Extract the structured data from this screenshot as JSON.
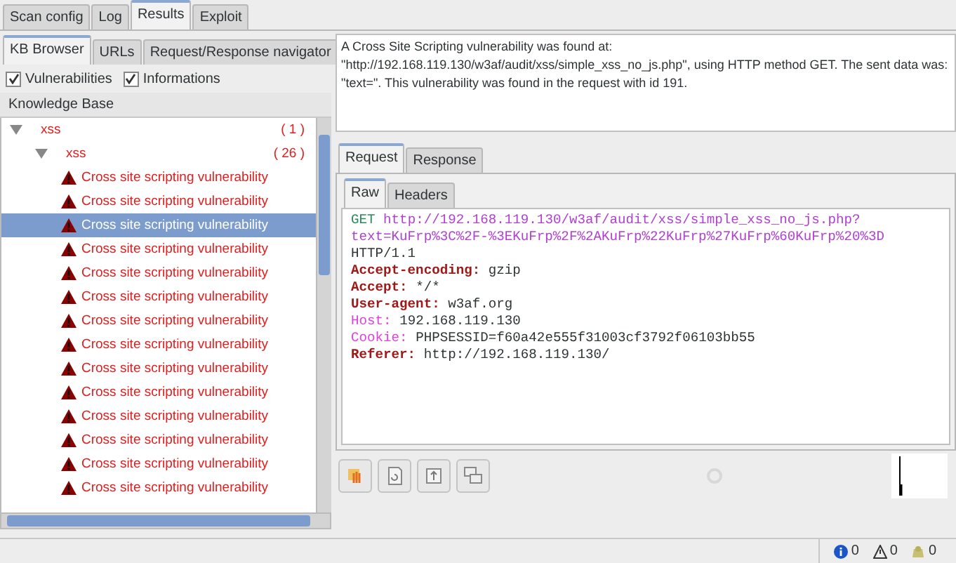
{
  "main_tabs": [
    {
      "label": "Scan config",
      "selected": false
    },
    {
      "label": "Log",
      "selected": false
    },
    {
      "label": "Results",
      "selected": true
    },
    {
      "label": "Exploit",
      "selected": false
    }
  ],
  "kb_tabs": [
    {
      "label": "KB Browser",
      "selected": true
    },
    {
      "label": "URLs",
      "selected": false
    },
    {
      "label": "Request/Response navigator",
      "selected": false
    }
  ],
  "filters": [
    {
      "label": "Vulnerabilities",
      "checked": true
    },
    {
      "label": "Informations",
      "checked": true
    }
  ],
  "tree": {
    "header": "Knowledge Base",
    "items": [
      {
        "label": "xss",
        "count": "( 1 )",
        "expanded": true,
        "children": [
          {
            "label": "xss",
            "count": "( 26 )",
            "expanded": true,
            "children": [
              {
                "label": "Cross site scripting vulnerability",
                "selected": false
              },
              {
                "label": "Cross site scripting vulnerability",
                "selected": false
              },
              {
                "label": "Cross site scripting vulnerability",
                "selected": true
              },
              {
                "label": "Cross site scripting vulnerability",
                "selected": false
              },
              {
                "label": "Cross site scripting vulnerability",
                "selected": false
              },
              {
                "label": "Cross site scripting vulnerability",
                "selected": false
              },
              {
                "label": "Cross site scripting vulnerability",
                "selected": false
              },
              {
                "label": "Cross site scripting vulnerability",
                "selected": false
              },
              {
                "label": "Cross site scripting vulnerability",
                "selected": false
              },
              {
                "label": "Cross site scripting vulnerability",
                "selected": false
              },
              {
                "label": "Cross site scripting vulnerability",
                "selected": false
              },
              {
                "label": "Cross site scripting vulnerability",
                "selected": false
              },
              {
                "label": "Cross site scripting vulnerability",
                "selected": false
              },
              {
                "label": "Cross site scripting vulnerability",
                "selected": false
              }
            ]
          }
        ]
      }
    ]
  },
  "description": "A Cross Site Scripting vulnerability was found at: \"http://192.168.119.130/w3af/audit/xss/simple_xss_no_js.php\", using HTTP method GET. The sent data was: \"text=\". This vulnerability was found in the request with id 191.",
  "request_tabs": [
    {
      "label": "Request",
      "selected": true
    },
    {
      "label": "Response",
      "selected": false
    }
  ],
  "view_tabs": [
    {
      "label": "Raw",
      "selected": true
    },
    {
      "label": "Headers",
      "selected": false
    }
  ],
  "request": {
    "method": "GET",
    "url_lines": [
      "http://192.168.119.130/w3af/audit/xss/simple_xss_no_js.php?",
      "text=KuFrp%3C%2F-%3EKuFrp%2F%2AKuFrp%22KuFrp%27KuFrp%60KuFrp%20%3D"
    ],
    "version": "HTTP/1.1",
    "headers": [
      {
        "name": "Accept-encoding:",
        "value": "gzip",
        "kind": "known"
      },
      {
        "name": "Accept:",
        "value": "*/*",
        "kind": "known"
      },
      {
        "name": "User-agent:",
        "value": "w3af.org",
        "kind": "known"
      },
      {
        "name": "Host:",
        "value": "192.168.119.130",
        "kind": "other"
      },
      {
        "name": "Cookie:",
        "value": "PHPSESSID=f60a42e555f31003cf3792f06103bb55",
        "kind": "other"
      },
      {
        "name": "Referer:",
        "value": "http://192.168.119.130/",
        "kind": "known"
      }
    ]
  },
  "status_bar": {
    "counters": [
      {
        "kind": "info",
        "count": "0"
      },
      {
        "kind": "warning",
        "count": "0"
      },
      {
        "kind": "error",
        "count": "0"
      }
    ]
  }
}
